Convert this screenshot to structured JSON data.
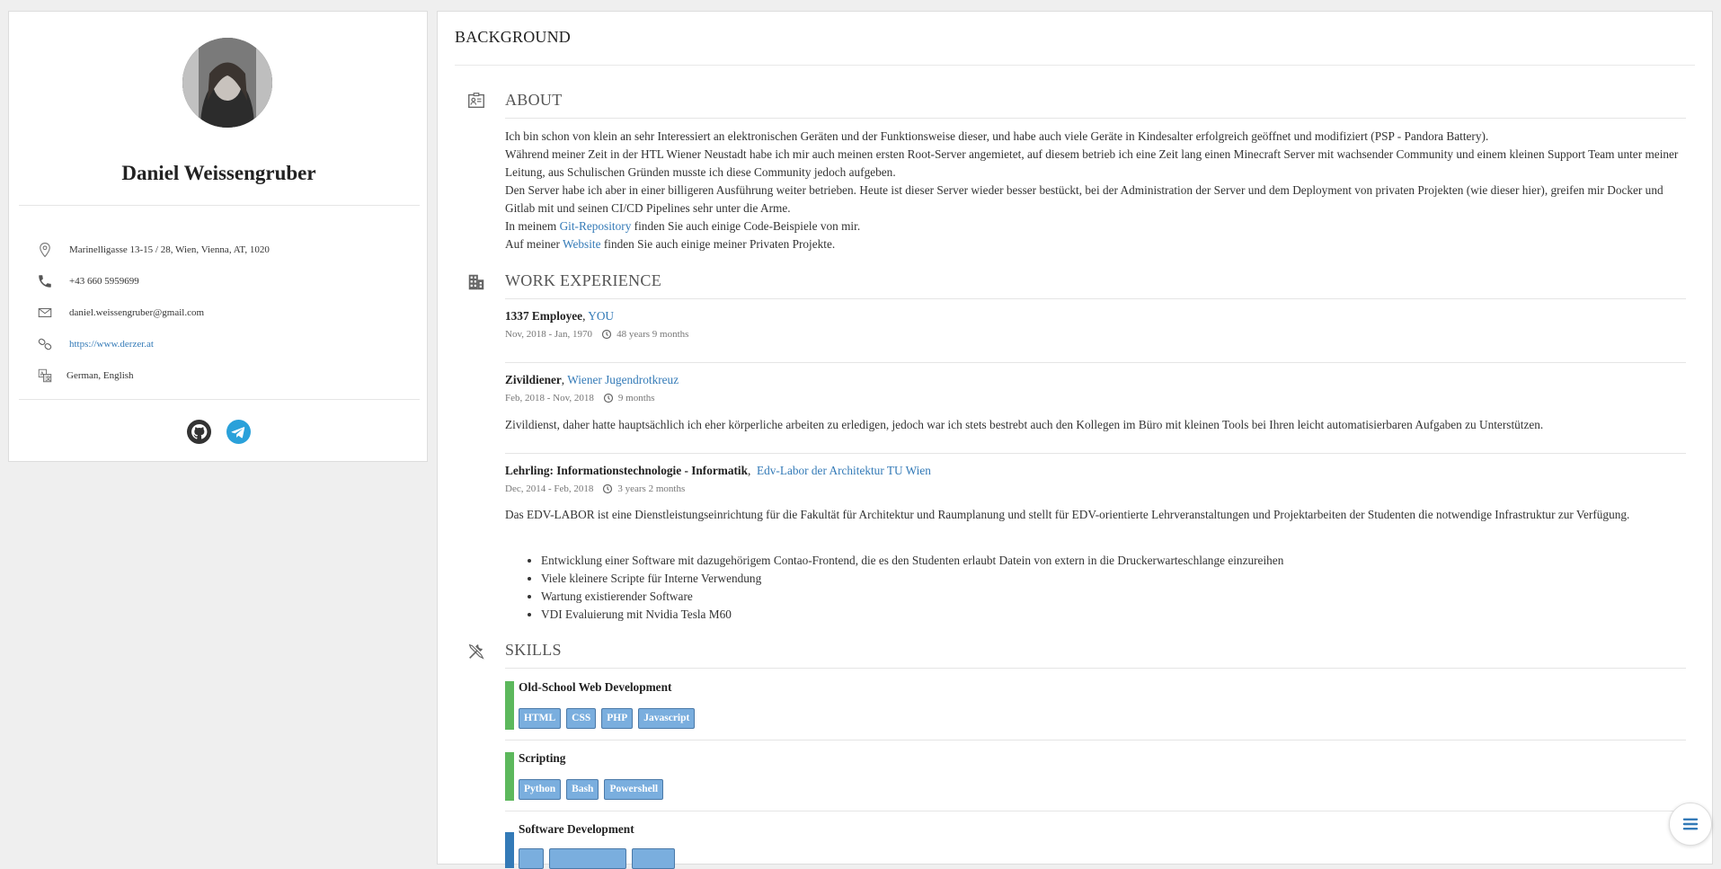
{
  "profile": {
    "name": "Daniel Weissengruber",
    "address": "Marinelligasse 13-15 / 28, Wien, Vienna, AT, 1020",
    "phone": "+43 660 5959699",
    "email": "daniel.weissengruber@gmail.com",
    "website": "https://www.derzer.at",
    "languages": "German, English",
    "socials": [
      {
        "name": "GitHub",
        "icon": "github-icon",
        "color": "#333333"
      },
      {
        "name": "Telegram",
        "icon": "telegram-icon",
        "color": "#2aa1da"
      }
    ]
  },
  "main": {
    "title": "BACKGROUND",
    "about": {
      "heading": "ABOUT",
      "p1": "Ich bin schon von klein an sehr Interessiert an elektronischen Geräten und der Funktionsweise dieser, und habe auch viele Geräte in Kindesalter erfolgreich geöffnet und modifiziert (PSP - Pandora Battery).",
      "p2": "Während meiner Zeit in der HTL Wiener Neustadt habe ich mir auch meinen ersten Root-Server angemietet, auf diesem betrieb ich eine Zeit lang einen Minecraft Server mit wachsender Community und einem kleinen Support Team unter meiner Leitung, aus Schulischen Gründen musste ich diese Community jedoch aufgeben.",
      "p3": "Den Server habe ich aber in einer billigeren Ausführung weiter betrieben. Heute ist dieser Server wieder besser bestückt, bei der Administration der Server und dem Deployment von privaten Projekten (wie dieser hier), greifen mir Docker und Gitlab mit und seinen CI/CD Pipelines sehr unter die Arme.",
      "p4_pre": "In meinem ",
      "p4_link": "Git-Repository",
      "p4_post": " finden Sie auch einige Code-Beispiele von mir.",
      "p5_pre": "Auf meiner ",
      "p5_link": "Website",
      "p5_post": " finden Sie auch einige meiner Privaten Projekte."
    },
    "work": {
      "heading": "WORK EXPERIENCE",
      "jobs": [
        {
          "role": "1337 Employee",
          "company": "YOU",
          "dates": "Nov, 2018 - Jan, 1970",
          "duration": "48 years 9 months"
        },
        {
          "role": "Zivildiener",
          "company": "Wiener Jugendrotkreuz",
          "dates": "Feb, 2018 - Nov, 2018",
          "duration": "9 months",
          "description": "Zivildienst, daher hatte hauptsächlich ich eher körperliche arbeiten zu erledigen, jedoch war ich stets bestrebt auch den Kollegen im Büro mit kleinen Tools bei Ihren leicht automatisierbaren Aufgaben zu Unterstützen."
        },
        {
          "role": "Lehrling: Informationstechnologie - Informatik",
          "company": "Edv-Labor der Architektur TU Wien",
          "dates": "Dec, 2014 - Feb, 2018",
          "duration": "3 years 2 months",
          "description": "Das EDV-LABOR ist eine Dienstleistungseinrichtung für die Fakultät für Architektur und Raumplanung und stellt für EDV-orientierte Lehrveranstaltungen und Projektarbeiten der Studenten die notwendige Infrastruktur zur Verfügung.",
          "bullets": [
            "Entwicklung einer Software mit dazugehörigem Contao-Frontend, die es den Studenten erlaubt Datein von extern in die Druckerwarteschlange einzureihen",
            "Viele kleinere Scripte für Interne Verwendung",
            "Wartung existierender Software",
            "VDI Evaluierung mit Nvidia Tesla M60"
          ]
        }
      ]
    },
    "skills": {
      "heading": "SKILLS",
      "groups": [
        {
          "title": "Old-School Web Development",
          "level_color": "#5cb85c",
          "tags": [
            "HTML",
            "CSS",
            "PHP",
            "Javascript"
          ]
        },
        {
          "title": "Scripting",
          "level_color": "#5cb85c",
          "tags": [
            "Python",
            "Bash",
            "Powershell"
          ]
        },
        {
          "title": "Software Development",
          "level_color": "#337ab7",
          "tags": [
            "",
            "",
            ""
          ]
        }
      ]
    }
  }
}
